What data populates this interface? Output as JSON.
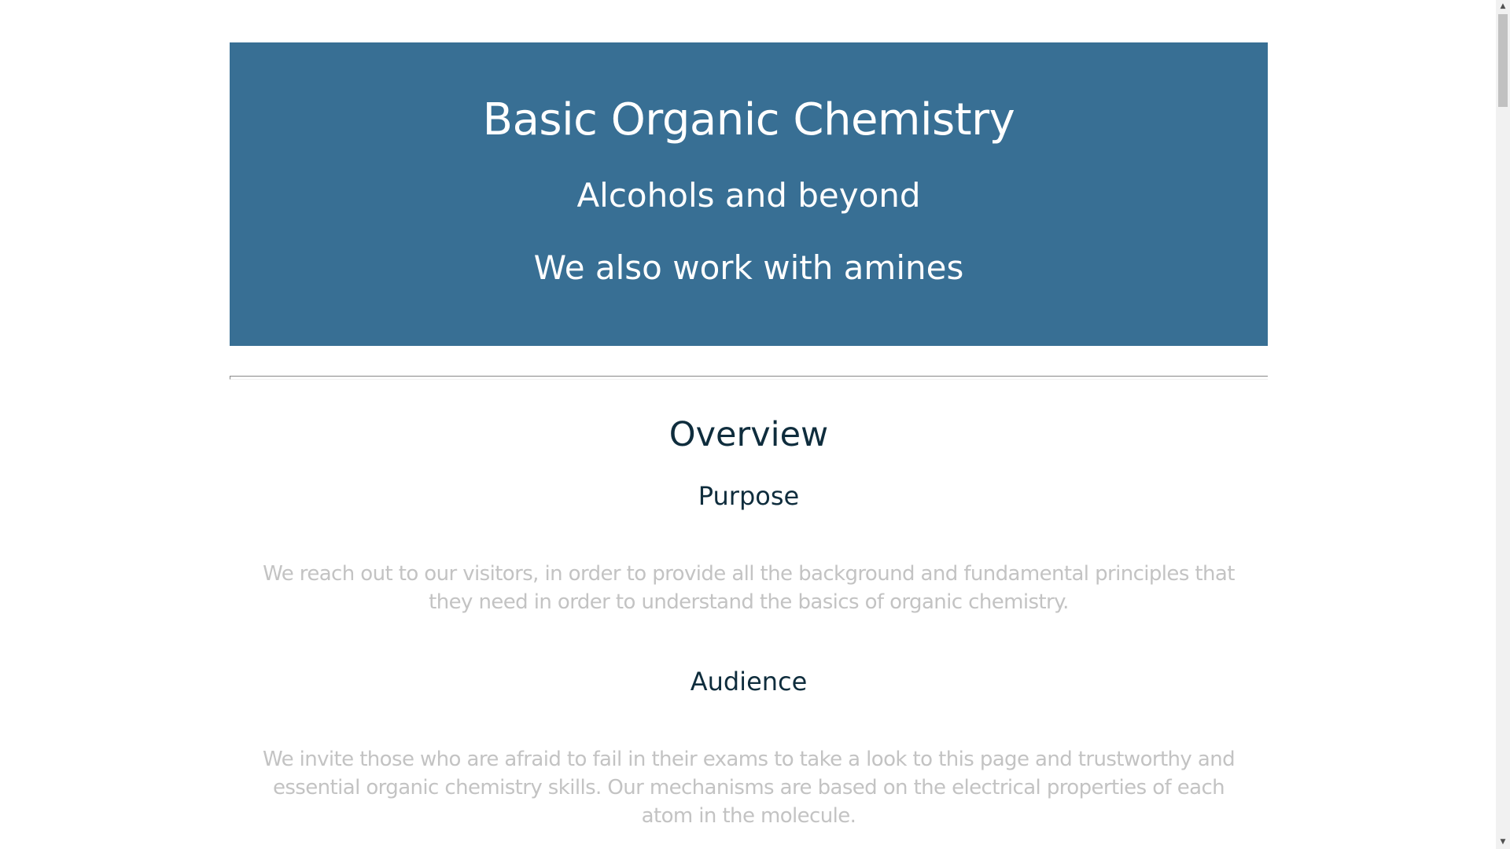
{
  "hero": {
    "title": "Basic Organic Chemistry",
    "subtitle": "Alcohols and beyond",
    "tagline": "We also work with amines",
    "background_color": "#386f94"
  },
  "overview": {
    "title": "Overview",
    "purpose": {
      "heading": "Purpose",
      "text": "We reach out to our visitors, in order to provide all the background and fundamental principles that they need in order to understand the basics of organic chemistry."
    },
    "audience": {
      "heading": "Audience",
      "text": "We invite those who are afraid to fail in their exams to take a look to this page and trustworthy and essential organic chemistry skills. Our mechanisms are based on the electrical properties of each atom in the molecule."
    }
  },
  "scrollbar": {
    "up_icon": "arrow-up-icon",
    "down_icon": "arrow-down-icon"
  }
}
